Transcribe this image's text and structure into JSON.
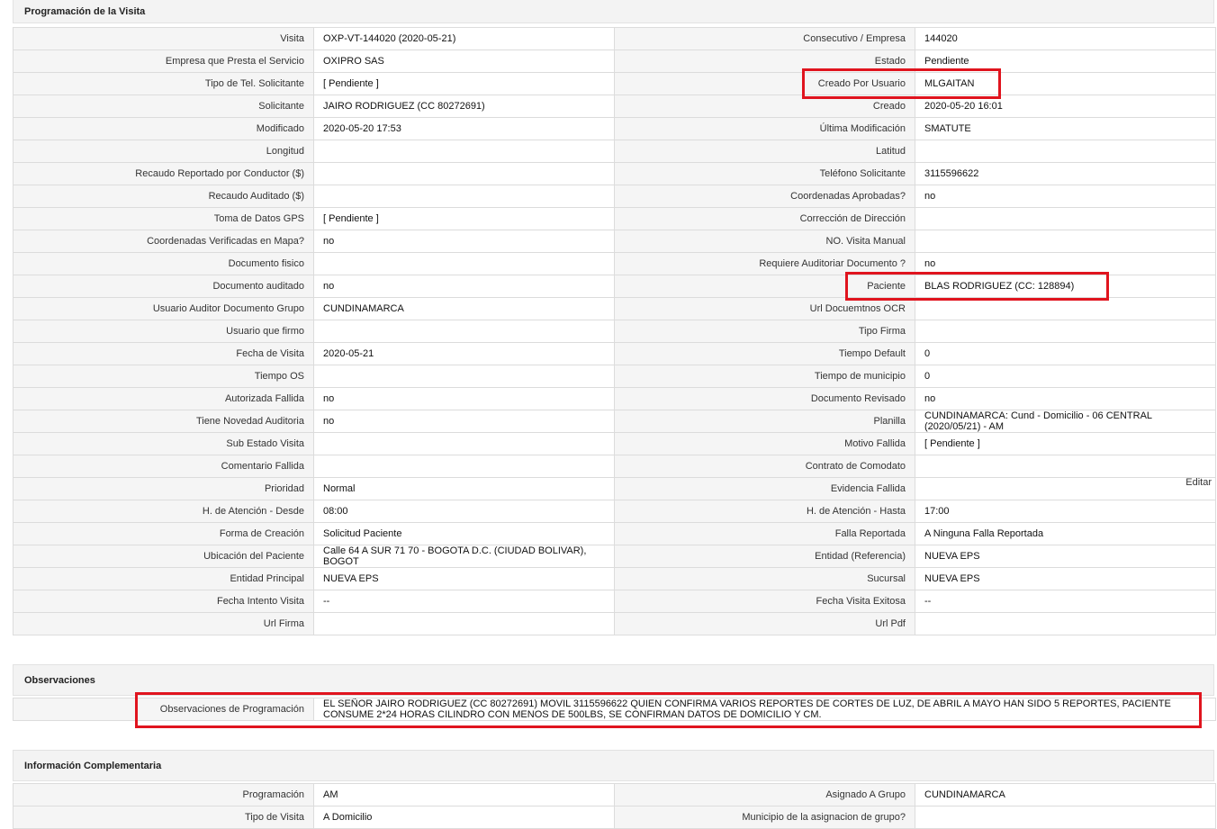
{
  "sections": {
    "programacion": "Programación de la Visita",
    "observaciones": "Observaciones",
    "info_complementaria": "Información Complementaria"
  },
  "prog_rows": [
    {
      "l1": "Visita",
      "v1": "OXP-VT-144020 (2020-05-21)",
      "l2": "Consecutivo / Empresa",
      "v2": "144020"
    },
    {
      "l1": "Empresa que Presta el Servicio",
      "v1": "OXIPRO SAS",
      "l2": "Estado",
      "v2": "Pendiente"
    },
    {
      "l1": "Tipo de Tel. Solicitante",
      "v1": "[ Pendiente ]",
      "l2": "Creado Por Usuario",
      "v2": "MLGAITAN"
    },
    {
      "l1": "Solicitante",
      "v1": "JAIRO RODRIGUEZ (CC 80272691)",
      "l2": "Creado",
      "v2": "2020-05-20 16:01"
    },
    {
      "l1": "Modificado",
      "v1": "2020-05-20 17:53",
      "l2": "Última Modificación",
      "v2": " SMATUTE"
    },
    {
      "l1": "Longitud",
      "v1": "",
      "l2": "Latitud",
      "v2": ""
    },
    {
      "l1": "Recaudo Reportado por Conductor ($)",
      "v1": "",
      "l2": "Teléfono Solicitante",
      "v2": "3115596622"
    },
    {
      "l1": "Recaudo Auditado ($)",
      "v1": "",
      "l2": "Coordenadas Aprobadas?",
      "v2": " no"
    },
    {
      "l1": "Toma de Datos GPS",
      "v1": "[ Pendiente ]",
      "l2": "Corrección de Dirección",
      "v2": ""
    },
    {
      "l1": "Coordenadas Verificadas en Mapa?",
      "v1": " no",
      "l2": "NO. Visita Manual",
      "v2": ""
    },
    {
      "l1": "Documento fisico",
      "v1": "",
      "l2": "Requiere Auditoriar Documento ?",
      "v2": " no"
    },
    {
      "l1": "Documento auditado",
      "v1": " no",
      "l2": "Paciente",
      "v2": "BLAS RODRIGUEZ (CC: 128894)"
    },
    {
      "l1": "Usuario Auditor Documento Grupo",
      "v1": "CUNDINAMARCA",
      "l2": "Url Docuemtnos OCR",
      "v2": ""
    },
    {
      "l1": "Usuario que firmo",
      "v1": "",
      "l2": "Tipo Firma",
      "v2": ""
    },
    {
      "l1": "Fecha de Visita",
      "v1": " 2020-05-21",
      "l2": "Tiempo Default",
      "v2": "0"
    },
    {
      "l1": "Tiempo OS",
      "v1": "",
      "l2": "Tiempo de municipio",
      "v2": "0"
    },
    {
      "l1": "Autorizada Fallida",
      "v1": " no",
      "l2": "Documento Revisado",
      "v2": " no"
    },
    {
      "l1": "Tiene Novedad Auditoria",
      "v1": " no",
      "l2": "Planilla",
      "v2": "CUNDINAMARCA: Cund - Domicilio - 06 CENTRAL (2020/05/21) - AM"
    },
    {
      "l1": "Sub Estado Visita",
      "v1": "",
      "l2": "Motivo Fallida",
      "v2": "[ Pendiente ]"
    },
    {
      "l1": "Comentario Fallida",
      "v1": "",
      "l2": "Contrato de Comodato",
      "v2": ""
    },
    {
      "l1": "Prioridad",
      "v1": "Normal",
      "l2": "Evidencia Fallida",
      "v2": ""
    },
    {
      "l1": "H. de Atención - Desde",
      "v1": "08:00",
      "l2": "H. de Atención - Hasta",
      "v2": "17:00"
    },
    {
      "l1": "Forma de Creación",
      "v1": "Solicitud Paciente",
      "l2": "Falla Reportada",
      "v2": "A Ninguna Falla Reportada"
    },
    {
      "l1": "Ubicación del Paciente",
      "v1": "Calle 64 A SUR 71 70 - BOGOTA D.C. (CIUDAD BOLIVAR), BOGOT",
      "l2": "Entidad (Referencia)",
      "v2": "NUEVA EPS"
    },
    {
      "l1": "Entidad Principal",
      "v1": "NUEVA EPS",
      "l2": "Sucursal",
      "v2": "NUEVA EPS"
    },
    {
      "l1": "Fecha Intento Visita",
      "v1": " --",
      "l2": "Fecha Visita Exitosa",
      "v2": " --"
    },
    {
      "l1": "Url Firma",
      "v1": "",
      "l2": "Url Pdf",
      "v2": ""
    }
  ],
  "editar_label": "Editar",
  "observaciones": {
    "label": "Observaciones de Programación",
    "value": "EL SEÑOR JAIRO RODRIGUEZ (CC 80272691) MOVIL 3115596622 QUIEN CONFIRMA VARIOS REPORTES DE CORTES DE LUZ, DE ABRIL A MAYO HAN SIDO 5 REPORTES, PACIENTE CONSUME 2*24 HORAS CILINDRO CON MENOS DE 500LBS, SE CONFIRMAN DATOS DE DOMICILIO Y CM."
  },
  "info_rows": [
    {
      "l1": "Programación",
      "v1": "AM",
      "l2": "Asignado A Grupo",
      "v2": "CUNDINAMARCA"
    },
    {
      "l1": "Tipo de Visita",
      "v1": "A Domicilio",
      "l2": "Municipio de la asignacion de grupo?",
      "v2": ""
    }
  ],
  "colors": {
    "highlight": "#e0141e",
    "label_bg": "#f5f5f5",
    "header_bg": "#f3f3f3",
    "border": "#dcdcdc"
  }
}
